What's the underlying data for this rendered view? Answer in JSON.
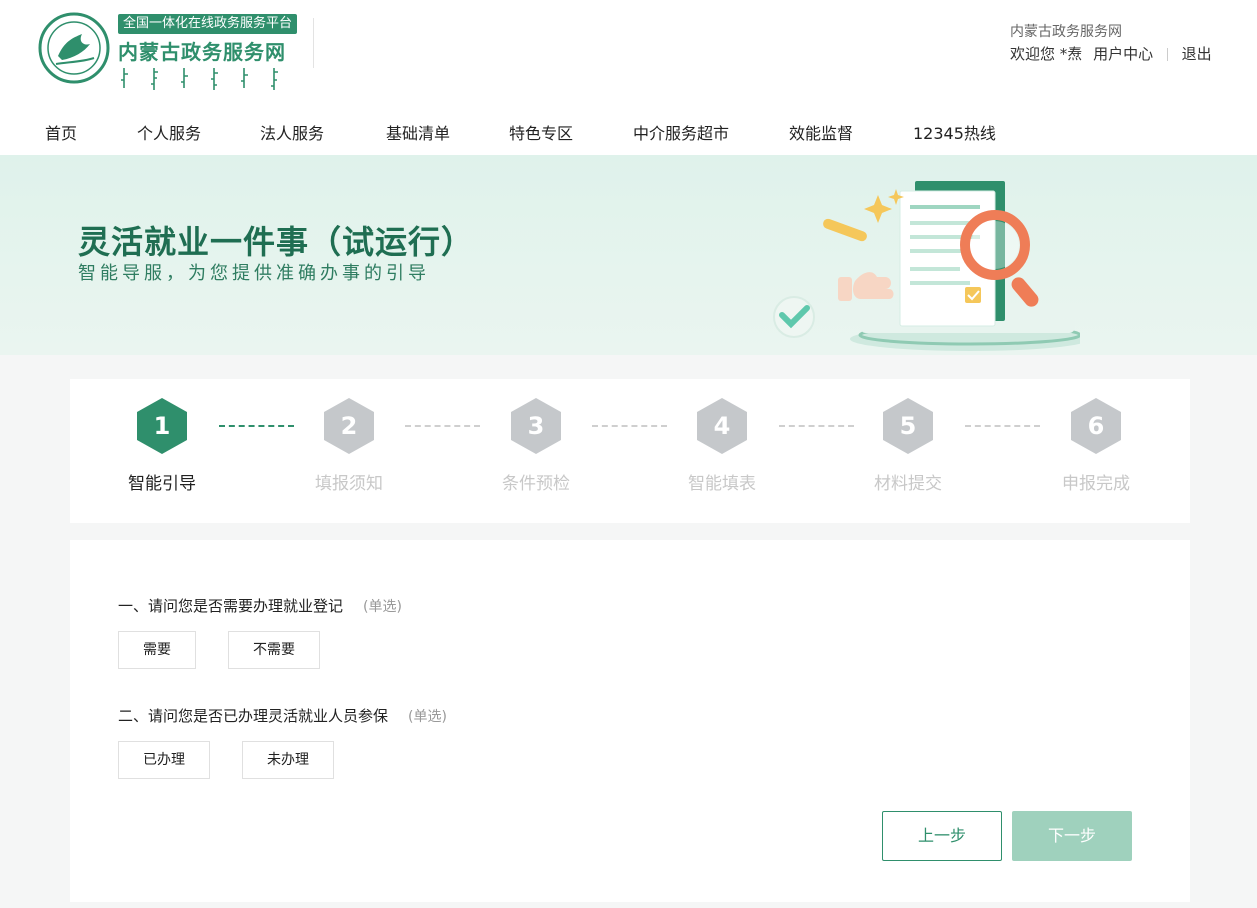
{
  "header": {
    "logo_tag": "全国一体化在线政务服务平台",
    "logo_title": "内蒙古政务服务网",
    "logo_mongolian": "ᠦᠪᠦᠷ ᠮᠣᠩᠭᠣᠯ",
    "site_name": "内蒙古政务服务网",
    "welcome": "欢迎您 *焘",
    "user_center": "用户中心",
    "logout": "退出"
  },
  "nav": [
    {
      "label": "首页"
    },
    {
      "label": "个人服务"
    },
    {
      "label": "法人服务"
    },
    {
      "label": "基础清单"
    },
    {
      "label": "特色专区"
    },
    {
      "label": "中介服务超市"
    },
    {
      "label": "效能监督"
    },
    {
      "label": "12345热线"
    }
  ],
  "banner": {
    "title": "灵活就业一件事（试运行）",
    "subtitle": "智能导服，为您提供准确办事的引导"
  },
  "steps": [
    {
      "num": "1",
      "label": "智能引导",
      "active": true
    },
    {
      "num": "2",
      "label": "填报须知",
      "active": false
    },
    {
      "num": "3",
      "label": "条件预检",
      "active": false
    },
    {
      "num": "4",
      "label": "智能填表",
      "active": false
    },
    {
      "num": "5",
      "label": "材料提交",
      "active": false
    },
    {
      "num": "6",
      "label": "申报完成",
      "active": false
    }
  ],
  "questions": [
    {
      "text": "一、请问您是否需要办理就业登记",
      "hint": "(单选)",
      "options": [
        "需要",
        "不需要"
      ]
    },
    {
      "text": "二、请问您是否已办理灵活就业人员参保",
      "hint": "(单选)",
      "options": [
        "已办理",
        "未办理"
      ]
    }
  ],
  "buttons": {
    "prev": "上一步",
    "next": "下一步"
  },
  "colors": {
    "brand": "#2f8f6c",
    "step_inactive": "#c5c8cb",
    "next_disabled": "#9fd1bd"
  }
}
